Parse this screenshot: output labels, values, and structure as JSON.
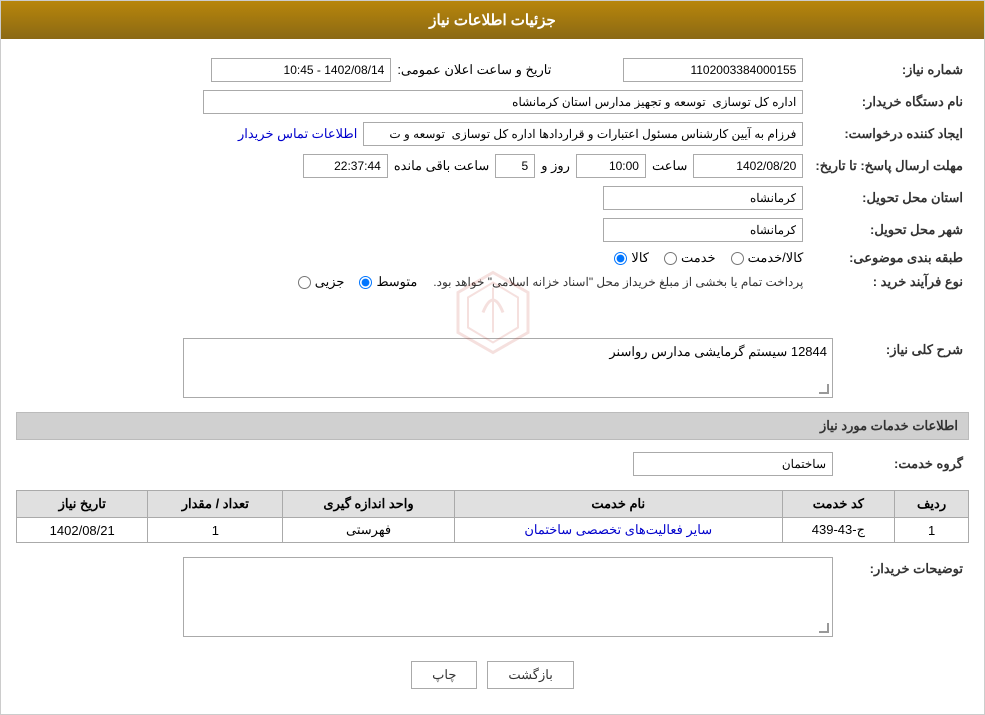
{
  "header": {
    "title": "جزئیات اطلاعات نیاز"
  },
  "fields": {
    "need_number_label": "شماره نیاز:",
    "need_number_value": "1102003384000155",
    "announce_date_label": "تاریخ و ساعت اعلان عمومی:",
    "announce_date_value": "1402/08/14 - 10:45",
    "buyer_org_label": "نام دستگاه خریدار:",
    "buyer_org_value": "اداره کل توسازی  توسعه و تجهیز مدارس استان کرمانشاه",
    "creator_label": "ایجاد کننده درخواست:",
    "creator_value": "فرزام به آیین کارشناس مسئول اعتبارات و قراردادها اداره کل توسازی  توسعه و ت",
    "creator_link": "اطلاعات تماس خریدار",
    "deadline_label": "مهلت ارسال پاسخ: تا تاریخ:",
    "deadline_date": "1402/08/20",
    "deadline_time_label": "ساعت",
    "deadline_time": "10:00",
    "deadline_day_label": "روز و",
    "deadline_days": "5",
    "deadline_remaining_label": "ساعت باقی مانده",
    "deadline_remaining": "22:37:44",
    "delivery_province_label": "استان محل تحویل:",
    "delivery_province_value": "کرمانشاه",
    "delivery_city_label": "شهر محل تحویل:",
    "delivery_city_value": "کرمانشاه",
    "category_label": "طبقه بندی موضوعی:",
    "category_options": [
      {
        "id": "kala",
        "label": "کالا"
      },
      {
        "id": "khedmat",
        "label": "خدمت"
      },
      {
        "id": "kala_khedmat",
        "label": "کالا/خدمت"
      }
    ],
    "category_selected": "kala",
    "purchase_type_label": "نوع فرآیند خرید :",
    "purchase_type_options": [
      {
        "id": "jozvi",
        "label": "جزیی"
      },
      {
        "id": "motavasset",
        "label": "متوسط"
      }
    ],
    "purchase_type_note": "پرداخت تمام یا بخشی از مبلغ خریداز محل \"اسناد خزانه اسلامی\" خواهد بود.",
    "purchase_type_selected": "motavasset"
  },
  "description_section": {
    "title": "شرح کلی نیاز:",
    "value": "12844 سیستم گرمایشی مدارس رواسنر"
  },
  "services_section": {
    "title": "اطلاعات خدمات مورد نیاز",
    "group_label": "گروه خدمت:",
    "group_value": "ساختمان",
    "table_headers": [
      "ردیف",
      "کد خدمت",
      "نام خدمت",
      "واحد اندازه گیری",
      "تعداد / مقدار",
      "تاریخ نیاز"
    ],
    "table_rows": [
      {
        "row": "1",
        "code": "ج-43-439",
        "name": "سایر فعالیت‌های تخصصی ساختمان",
        "unit": "فهرستی",
        "quantity": "1",
        "date": "1402/08/21"
      }
    ]
  },
  "buyer_notes_section": {
    "title": "توضیحات خریدار:",
    "value": ""
  },
  "buttons": {
    "print_label": "چاپ",
    "back_label": "بازگشت"
  }
}
